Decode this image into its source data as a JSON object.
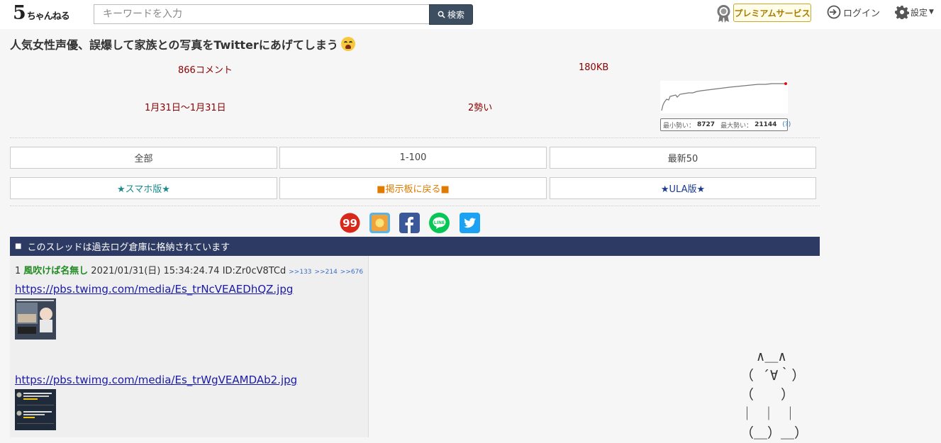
{
  "header": {
    "logo_five": "5",
    "logo_text": "ちゃんねる",
    "search_placeholder": "キーワードを入力",
    "search_label": "検索",
    "premium_label": "プレミアムサービス",
    "login_label": "ログイン",
    "settings_label": "設定"
  },
  "thread": {
    "title": "人気女性声優、誤爆して家族との写真をTwitterにあげてしまう",
    "comments": "866コメント",
    "size": "180KB",
    "date_range": "1月31日〜1月31日",
    "momentum": "2勢い",
    "graph": {
      "min_label": "最小勢い：",
      "min_value": "8727",
      "max_label": "最大勢い：",
      "max_value": "21144",
      "help": "(?)"
    }
  },
  "nav": {
    "all": "全部",
    "range": "1-100",
    "latest": "最新50",
    "smartphone": "★スマホ版★",
    "back": "■掲示板に戻る■",
    "ula": "★ULA版★"
  },
  "social": [
    "2ch-99-icon",
    "crowd-icon",
    "facebook-icon",
    "line-icon",
    "twitter-icon"
  ],
  "banner": {
    "mark": "■",
    "text": "このスレッドは過去ログ倉庫に格納されています"
  },
  "post": {
    "number": "1",
    "name": "風吹けば名無し",
    "date": "2021/01/31(日) 15:34:24.74 ID:Zr0cV8TCd",
    "refs": [
      ">>133",
      ">>214",
      ">>676"
    ],
    "links": [
      "https://pbs.twimg.com/media/Es_trNcVEAEDhQZ.jpg",
      "https://pbs.twimg.com/media/Es_trWgVEAMDAb2.jpg"
    ]
  },
  "ascii_art": "  ∧＿∧\n（ ´∀｀）\n（　　）\n｜ ｜ ｜\n（＿）＿）",
  "colors": {
    "banner_bg": "#2d3a63",
    "search_btn": "#3d4e61",
    "stat_text": "#8b0000",
    "name_green": "#228b22",
    "link_blue": "#1a1aa6",
    "smartphone_teal": "#1a8a8a",
    "back_orange": "#e07b00",
    "ula_navy": "#1a3a8f"
  }
}
